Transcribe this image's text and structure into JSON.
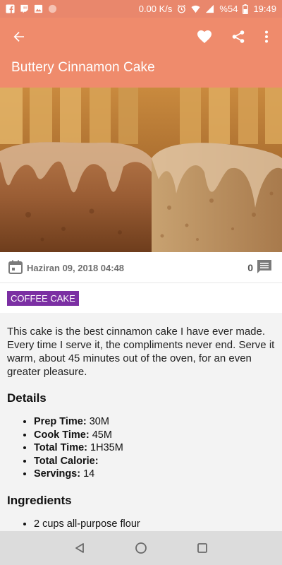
{
  "status_bar": {
    "network_speed": "0.00 K/s",
    "battery": "%54",
    "time": "19:49",
    "icons": [
      "facebook-icon",
      "twitch-icon",
      "image-icon",
      "circle-icon",
      "alarm-icon",
      "wifi-icon",
      "signal-icon",
      "battery-icon"
    ]
  },
  "app_bar": {
    "title": "Buttery Cinnamon Cake",
    "icons": [
      "back-arrow-icon",
      "heart-icon",
      "share-icon",
      "more-vert-icon"
    ],
    "color": "#ef8b6c"
  },
  "post": {
    "date": "Haziran 09, 2018 04:48",
    "comment_count": "0",
    "category": "COFFEE CAKE",
    "category_color": "#7b2fa3",
    "description": "This cake is the best cinnamon cake I have ever made. Every time I serve it, the compliments never end. Serve it warm, about 45 minutes out of the oven, for an even greater pleasure."
  },
  "details": {
    "title": "Details",
    "items": [
      {
        "label": "Prep Time:",
        "value": " 30M"
      },
      {
        "label": "Cook Time:",
        "value": " 45M"
      },
      {
        "label": "Total Time:",
        "value": " 1H35M"
      },
      {
        "label": "Total Calorie:",
        "value": ""
      },
      {
        "label": "Servings:",
        "value": " 14"
      }
    ]
  },
  "ingredients": {
    "title": "Ingredients",
    "items": [
      "2 cups all-purpose flour"
    ]
  },
  "nav_bar": {
    "icons": [
      "back-triangle-icon",
      "home-circle-icon",
      "recents-square-icon"
    ]
  }
}
